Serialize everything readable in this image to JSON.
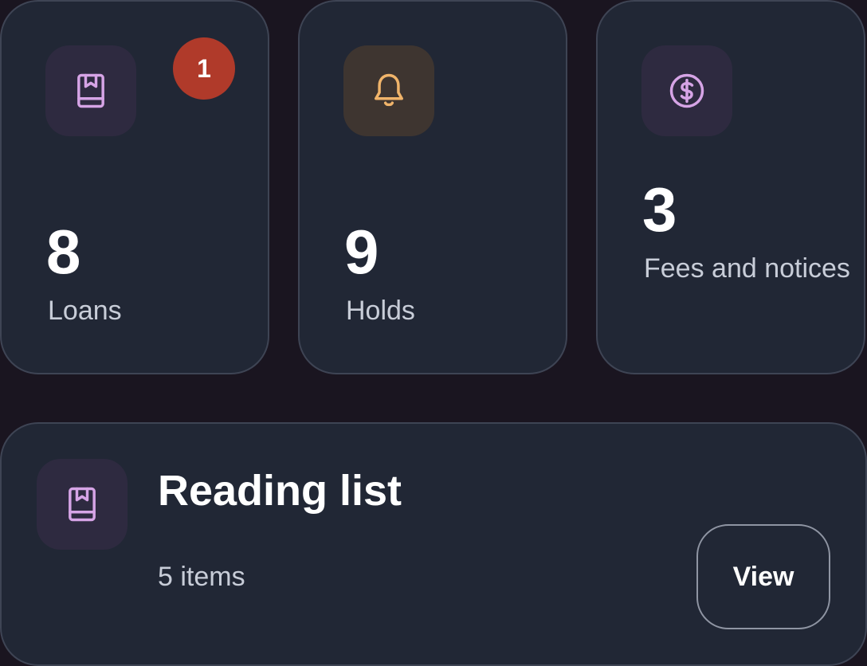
{
  "stats": {
    "loans": {
      "value": "8",
      "label": "Loans",
      "badge": "1",
      "icon": "book-icon"
    },
    "holds": {
      "value": "9",
      "label": "Holds",
      "icon": "bell-icon"
    },
    "fees": {
      "value": "3",
      "label": "Fees and notices",
      "icon": "dollar-circle-icon"
    }
  },
  "reading_list": {
    "title": "Reading list",
    "count": "5 items",
    "action_label": "View",
    "icon": "book-icon"
  },
  "colors": {
    "background": "#1a1520",
    "card": "#212735",
    "card_border": "#3e4454",
    "badge": "#b03a2a",
    "icon_purple": "#d6a4e6",
    "icon_amber": "#f0b46a"
  }
}
